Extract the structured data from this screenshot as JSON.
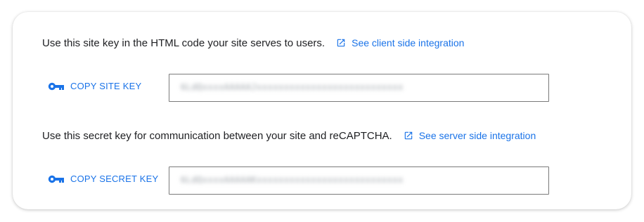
{
  "colors": {
    "accent": "#1a73e8",
    "text": "#202124",
    "border": "#7a7a7a"
  },
  "site_key": {
    "description": "Use this site key in the HTML code your site serves to users.",
    "link_label": "See client side integration",
    "link_icon": "open-in-new-icon",
    "copy_label": "COPY SITE KEY",
    "copy_icon": "key-icon",
    "value": "6LdQxxxxAAAAAJxxxxxxxxxxxxxxxxxxxxxxxxxxx"
  },
  "secret_key": {
    "description": "Use this secret key for communication between your site and reCAPTCHA.",
    "link_label": "See server side integration",
    "link_icon": "open-in-new-icon",
    "copy_label": "COPY SECRET KEY",
    "copy_icon": "key-icon",
    "value": "6LdQxxxxAAAAAKxxxxxxxxxxxxxxxxxxxxxxxxxxx"
  }
}
